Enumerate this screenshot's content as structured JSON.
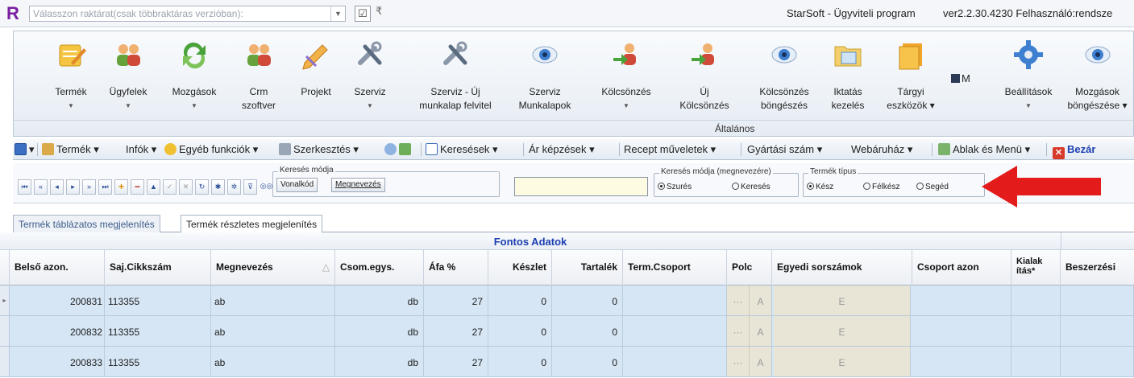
{
  "titlebar": {
    "logo": "R",
    "warehouse_placeholder": "Válasszon raktárat(csak többraktáras verzióban):",
    "window_title": "StarSoft - Ügyviteli program",
    "version": "ver2.2.30.4230 Felhasználó:rendsze"
  },
  "ribbon": {
    "buttons": [
      {
        "label1": "Termék",
        "label2": "",
        "dropdown": true,
        "icon": "pencil-notepad-icon"
      },
      {
        "label1": "Ügyfelek",
        "label2": "",
        "dropdown": true,
        "icon": "people-icon"
      },
      {
        "label1": "Mozgások",
        "label2": "",
        "dropdown": true,
        "icon": "refresh-arrows-icon"
      },
      {
        "label1": "Crm",
        "label2": "szoftver",
        "dropdown": false,
        "icon": "people-icon"
      },
      {
        "label1": "Projekt",
        "label2": "",
        "dropdown": false,
        "icon": "pencil-icon"
      },
      {
        "label1": "Szerviz",
        "label2": "",
        "dropdown": true,
        "icon": "tools-icon"
      },
      {
        "label1": "Szerviz - Új",
        "label2": "munkalap felvitel",
        "dropdown": false,
        "icon": "tools-icon"
      },
      {
        "label1": "Szerviz",
        "label2": "Munkalapok",
        "dropdown": false,
        "icon": "eye-icon"
      },
      {
        "label1": "Kölcsönzés",
        "label2": "",
        "dropdown": true,
        "icon": "person-arrow-icon"
      },
      {
        "label1": "Új",
        "label2": "Kölcsönzés",
        "dropdown": false,
        "icon": "person-arrow-icon"
      },
      {
        "label1": "Kölcsönzés",
        "label2": "böngészés",
        "dropdown": false,
        "icon": "eye-icon"
      },
      {
        "label1": "Iktatás",
        "label2": "kezelés",
        "dropdown": false,
        "icon": "folder-icon"
      },
      {
        "label1": "Tárgyi",
        "label2": "eszközök",
        "dropdown": true,
        "icon": "folder-stack-icon"
      },
      {
        "label1": "Beállítások",
        "label2": "",
        "dropdown": true,
        "icon": "gear-icon"
      },
      {
        "label1": "Mozgások",
        "label2": "böngészése",
        "dropdown": true,
        "icon": "eye-icon"
      }
    ],
    "save_m": "M",
    "group_label": "Általános"
  },
  "menubar": {
    "items": [
      {
        "label": "Termék",
        "dropdown": true,
        "icon": "box-icon"
      },
      {
        "label": "Infók",
        "dropdown": true
      },
      {
        "label": "Egyéb funkciók",
        "dropdown": true,
        "icon": "star-icon"
      },
      {
        "label": "Szerkesztés",
        "dropdown": true,
        "icon": "scissors-icon"
      },
      {
        "label": "Keresések",
        "dropdown": true,
        "icon": "search-icon"
      },
      {
        "label": "Ár képzések",
        "dropdown": true
      },
      {
        "label": "Recept műveletek",
        "dropdown": true
      },
      {
        "label": "Gyártási szám",
        "dropdown": true
      },
      {
        "label": "Webáruház",
        "dropdown": true
      },
      {
        "label": "Ablak és Menü",
        "dropdown": true,
        "icon": "windows-icon"
      },
      {
        "label": "Bezár",
        "dropdown": false,
        "icon": "close-icon"
      }
    ]
  },
  "toolbar": {
    "search_mode_legend": "Keresés módja",
    "barcode_button": "Vonalkód",
    "name_button": "Megnevezés",
    "name_search_legend": "Keresés módja (megnevezére)",
    "name_search_options": [
      {
        "label": "Szurés",
        "selected": true
      },
      {
        "label": "Keresés",
        "selected": false
      }
    ],
    "product_type_legend": "Termék típus",
    "product_type_options": [
      {
        "label": "Kész",
        "selected": true
      },
      {
        "label": "Félkész",
        "selected": false
      },
      {
        "label": "Segéd",
        "selected": false
      }
    ]
  },
  "tabs": [
    {
      "label": "Termék táblázatos megjelenítés",
      "active": false
    },
    {
      "label": "Termék részletes megjelenítés",
      "active": true
    }
  ],
  "grid": {
    "band_title": "Fontos Adatok",
    "headers": [
      "Belső azon.",
      "Saj.Cikkszám",
      "Megnevezés",
      "Csom.egys.",
      "Áfa %",
      "Készlet",
      "Tartalék",
      "Term.Csoport",
      "Polc",
      "Egyedi sorszámok",
      "Csoport azon",
      "Kialak ítás*",
      "Beszerzési"
    ],
    "rows": [
      {
        "id": "200831",
        "sku": "113355",
        "name": "ab",
        "unit": "db",
        "vat": "27",
        "stock": "0",
        "reserve": "0",
        "group": "",
        "shelf_dots": "···",
        "shelf_a": "A",
        "serial": "E"
      },
      {
        "id": "200832",
        "sku": "113355",
        "name": "ab",
        "unit": "db",
        "vat": "27",
        "stock": "0",
        "reserve": "0",
        "group": "",
        "shelf_dots": "···",
        "shelf_a": "A",
        "serial": "E"
      },
      {
        "id": "200833",
        "sku": "113355",
        "name": "ab",
        "unit": "db",
        "vat": "27",
        "stock": "0",
        "reserve": "0",
        "group": "",
        "shelf_dots": "···",
        "shelf_a": "A",
        "serial": "E"
      }
    ]
  },
  "colors": {
    "accent_blue": "#1b3fb0",
    "row_bg": "#d6e6f5",
    "arrow_red": "#e31b1b"
  }
}
